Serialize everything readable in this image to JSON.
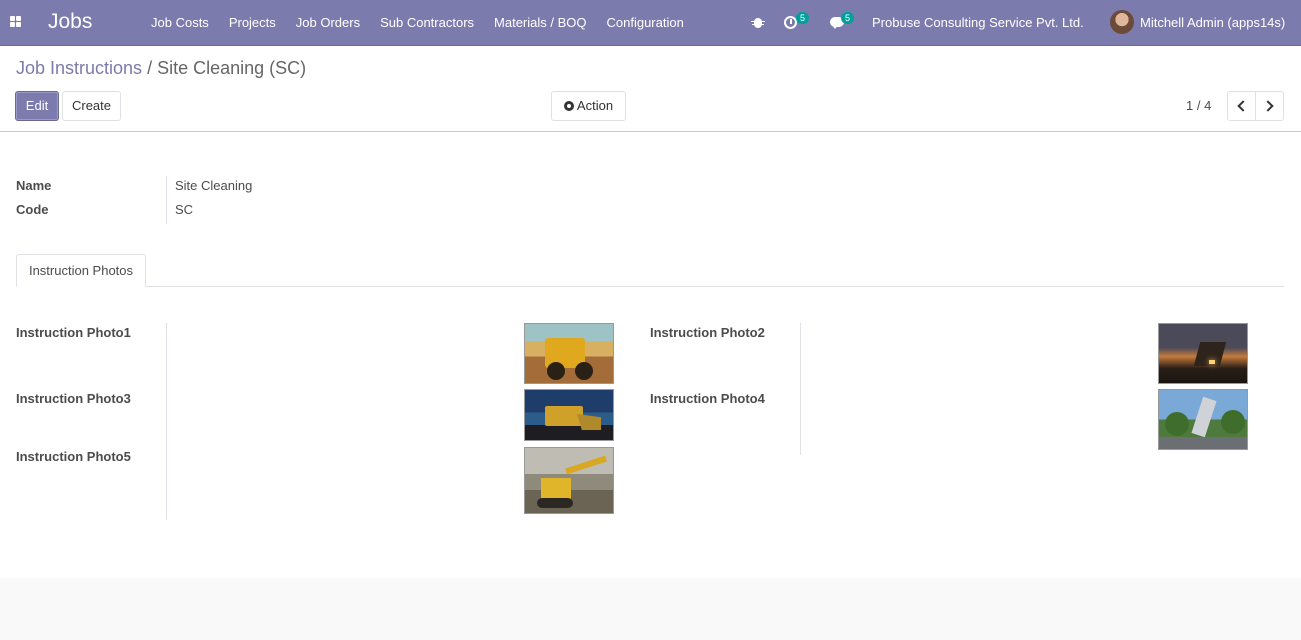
{
  "navbar": {
    "app_title": "Jobs",
    "menu": [
      "Job Costs",
      "Projects",
      "Job Orders",
      "Sub Contractors",
      "Materials / BOQ",
      "Configuration"
    ],
    "activity_count": "5",
    "message_count": "5",
    "company": "Probuse Consulting Service Pvt. Ltd.",
    "user": "Mitchell Admin (apps14s)",
    "accent_color": "#7c7bad"
  },
  "breadcrumb": {
    "parent": "Job Instructions",
    "separator": "/",
    "current": "Site Cleaning (SC)"
  },
  "buttons": {
    "edit": "Edit",
    "create": "Create",
    "action": "Action"
  },
  "pager": {
    "value": "1 / 4"
  },
  "form": {
    "fields": [
      {
        "label": "Name",
        "value": "Site Cleaning"
      },
      {
        "label": "Code",
        "value": "SC"
      }
    ],
    "tab": "Instruction Photos",
    "photos": [
      {
        "label": "Instruction Photo1",
        "image": "yellow-wheel-loader"
      },
      {
        "label": "Instruction Photo2",
        "image": "excavator-at-sunset"
      },
      {
        "label": "Instruction Photo3",
        "image": "bulldozer-at-night"
      },
      {
        "label": "Instruction Photo4",
        "image": "demolition-machine-with-trees"
      },
      {
        "label": "Instruction Photo5",
        "image": "yellow-excavator-on-site"
      }
    ]
  }
}
